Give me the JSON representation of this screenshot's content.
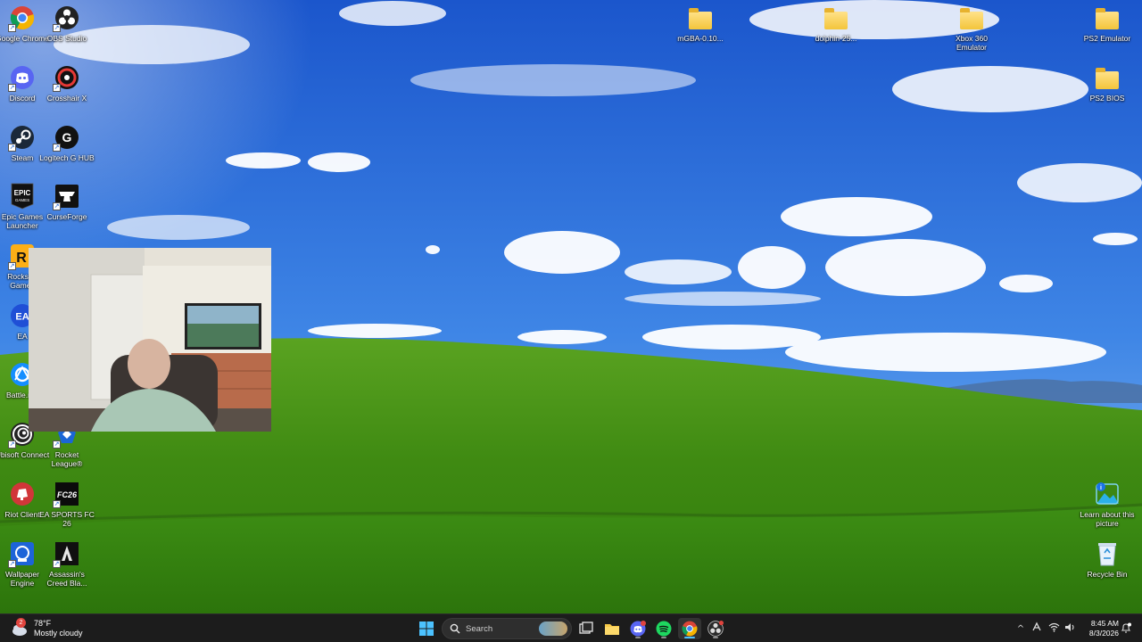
{
  "desktop": {
    "left_column_1": [
      {
        "label": "Google Chrome",
        "icon": "chrome-icon"
      },
      {
        "label": "Discord",
        "icon": "discord-icon"
      },
      {
        "label": "Steam",
        "icon": "steam-icon"
      },
      {
        "label": "Epic Games Launcher",
        "icon": "epic-games-icon"
      },
      {
        "label": "Rockstar Games",
        "icon": "rockstar-icon"
      },
      {
        "label": "EA",
        "icon": "ea-icon"
      },
      {
        "label": "Battle.net",
        "icon": "battlenet-icon"
      },
      {
        "label": "Ubisoft Connect",
        "icon": "ubisoft-icon"
      },
      {
        "label": "Riot Client",
        "icon": "riot-icon"
      },
      {
        "label": "Wallpaper Engine",
        "icon": "wallpaper-engine-icon"
      }
    ],
    "left_column_2": [
      {
        "label": "OBS Studio",
        "icon": "obs-icon"
      },
      {
        "label": "Crosshair X",
        "icon": "crosshair-icon"
      },
      {
        "label": "Logitech G HUB",
        "icon": "logitech-icon"
      },
      {
        "label": "CurseForge",
        "icon": "curseforge-icon"
      },
      {
        "label": "Rocket League®",
        "icon": "rocket-league-icon"
      },
      {
        "label": "EA SPORTS FC 26",
        "icon": "ea-fc-icon"
      },
      {
        "label": "Assassin's Creed Bla...",
        "icon": "assassins-creed-icon"
      }
    ],
    "top_folders": [
      {
        "label": "mGBA-0.10...",
        "icon": "folder-icon"
      },
      {
        "label": "dolphin-25...",
        "icon": "folder-icon"
      },
      {
        "label": "Xbox 360 Emulator",
        "icon": "folder-icon"
      },
      {
        "label": "PS2 Emulator",
        "icon": "folder-icon"
      },
      {
        "label": "PS2 BIOS",
        "icon": "folder-icon"
      }
    ],
    "right_bottom": [
      {
        "label": "Learn about this picture",
        "icon": "learn-picture-icon"
      },
      {
        "label": "Recycle Bin",
        "icon": "recycle-bin-icon"
      }
    ]
  },
  "taskbar": {
    "weather_temp": "78°F",
    "weather_desc": "Mostly cloudy",
    "weather_badge": "2",
    "search_placeholder": "Search",
    "apps": [
      "start-icon",
      "search-icon",
      "task-view-icon",
      "file-explorer-icon",
      "discord-icon",
      "spotify-icon",
      "chrome-icon",
      "obs-icon"
    ],
    "time": "8:45 AM",
    "date": "8/3/2026"
  },
  "colors": {
    "taskbar_bg": "#1c1c1c",
    "sky_top": "#1e5bd0",
    "grass": "#4e9a1e"
  }
}
